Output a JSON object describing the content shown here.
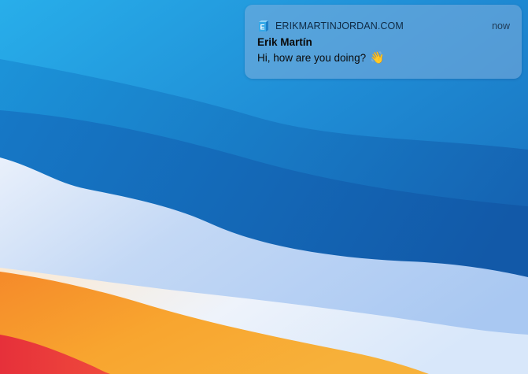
{
  "desktop": {
    "colors": {
      "sky_top": "#24a6e4",
      "sky_mid": "#1c7fc9",
      "wave_deep": "#1565b4",
      "wave_light": "#c9dcf7",
      "orange": "#f7a12c",
      "red": "#e8343c"
    }
  },
  "notification": {
    "app_icon": "letter-e-app-icon",
    "app_name": "ERIKMARTINJORDAN.COM",
    "timestamp": "now",
    "title": "Erik Martín",
    "message": "Hi, how are you doing?",
    "emoji": "👋",
    "emoji_icon": "waving-hand-icon"
  }
}
